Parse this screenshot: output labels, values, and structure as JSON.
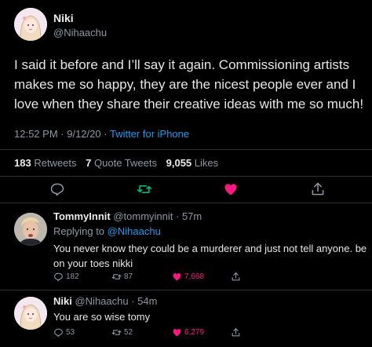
{
  "colors": {
    "background": "#000000",
    "link": "#1d9bf0",
    "like": "#f91880",
    "retweet": "#00ba7c",
    "muted": "#8b98a5"
  },
  "tweet": {
    "author_name": "Niki",
    "author_handle": "@Nihaachu",
    "lines": [
      "I said it before and I’ll say it again. Commissioning artists",
      "makes me so happy, they are the nicest people ever and I",
      "love when they share their creative ideas with me so much!"
    ],
    "time": "12:52 PM",
    "date": "9/12/20",
    "source": "Twitter for iPhone",
    "retweets_count": "183",
    "retweets_label": "Retweets",
    "quotes_count": "7",
    "quotes_label": "Quote Tweets",
    "likes_count": "9,055",
    "likes_label": "Likes",
    "actions": {
      "reply_icon": "reply-icon",
      "retweet_icon": "retweet-icon",
      "like_icon": "heart-icon",
      "share_icon": "share-icon",
      "retweet_active": true,
      "liked": true
    }
  },
  "replies": [
    {
      "name": "TommyInnit",
      "handle": "@tommyinnit",
      "time": "57m",
      "replying_prefix": "Replying to",
      "replying_to": "@Nihaachu",
      "lines": [
        "You never know they could be a murderer and just not tell anyone. be",
        "on your toes nikki"
      ],
      "reply_count": "182",
      "retweet_count": "87",
      "like_count": "7,668",
      "liked": true
    },
    {
      "name": "Niki",
      "handle": "@Nihaachu",
      "time": "54m",
      "lines": [
        "You are so wise tomy"
      ],
      "reply_count": "53",
      "retweet_count": "52",
      "like_count": "6,279",
      "liked": true
    }
  ]
}
